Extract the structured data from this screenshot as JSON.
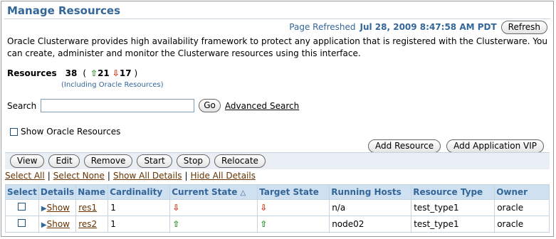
{
  "header": {
    "title": "Manage Resources",
    "refreshed_label": "Page Refreshed",
    "refreshed_value": "Jul 28, 2009 8:47:58 AM PDT",
    "refresh_button": "Refresh"
  },
  "description": "Oracle Clusterware provides high availability framework to protect any application that is registered with the Clusterware. You can create, administer and monitor the Clusterware resources using this interface.",
  "resources": {
    "label": "Resources",
    "total": "38",
    "open_paren": "(",
    "up_count": "21",
    "down_count": "17",
    "close_paren": ")",
    "note": "(Including Oracle Resources)"
  },
  "search": {
    "label": "Search",
    "value": "",
    "go_button": "Go",
    "advanced_link": "Advanced Search"
  },
  "show_oracle": {
    "label": "Show Oracle Resources",
    "checked": false
  },
  "buttons": {
    "add_resource": "Add Resource",
    "add_vip": "Add Application VIP"
  },
  "toolbar": [
    "View",
    "Edit",
    "Remove",
    "Start",
    "Stop",
    "Relocate"
  ],
  "selection": {
    "select_all": "Select All",
    "select_none": "Select None",
    "show_all_details": "Show All Details",
    "hide_all_details": "Hide All Details",
    "separator": "|"
  },
  "table": {
    "columns": [
      "Select",
      "Details",
      "Name",
      "Cardinality",
      "Current State",
      "Target State",
      "Running Hosts",
      "Resource Type",
      "Owner"
    ],
    "sort_indicator": "△",
    "rows": [
      {
        "details": "Show",
        "name": "res1",
        "cardinality": "1",
        "current_state": "down",
        "target_state": "down",
        "running_hosts": "n/a",
        "resource_type": "test_type1",
        "owner": "oracle"
      },
      {
        "details": "Show",
        "name": "res2",
        "cardinality": "1",
        "current_state": "up",
        "target_state": "up",
        "running_hosts": "node02",
        "resource_type": "test_type1",
        "owner": "oracle"
      }
    ]
  },
  "colors": {
    "title": "#336699",
    "up": "#2a8a2a",
    "down": "#d12a0e",
    "header_bg": "#cfe0f1"
  }
}
